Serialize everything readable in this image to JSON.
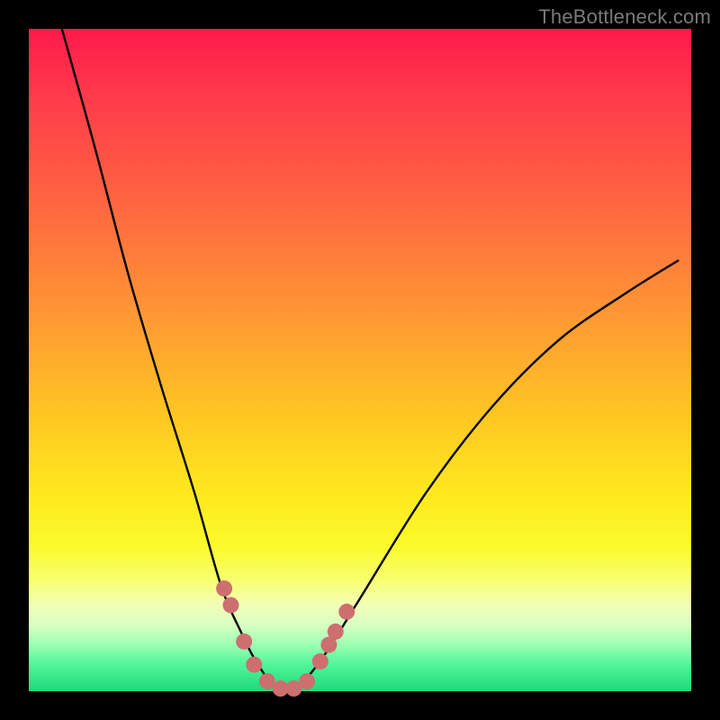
{
  "watermark": "TheBottleneck.com",
  "colors": {
    "frame": "#000000",
    "curve_stroke": "#000000",
    "marker_fill": "#cd6f6f",
    "marker_stroke": "#b85a5a"
  },
  "chart_data": {
    "type": "line",
    "title": "",
    "xlabel": "",
    "ylabel": "",
    "xlim": [
      0,
      100
    ],
    "ylim": [
      0,
      100
    ],
    "series": [
      {
        "name": "bottleneck-curve",
        "x": [
          5,
          10,
          15,
          20,
          25,
          29,
          32,
          34,
          36,
          38,
          40,
          42,
          45,
          50,
          60,
          70,
          80,
          90,
          98
        ],
        "y": [
          100,
          82,
          63,
          46,
          30,
          16,
          9,
          5,
          2,
          0,
          0,
          2,
          6,
          14,
          30,
          43,
          53,
          60,
          65
        ]
      }
    ],
    "markers": [
      {
        "x": 29.5,
        "y": 15.5
      },
      {
        "x": 30.5,
        "y": 13.0
      },
      {
        "x": 32.5,
        "y": 7.5
      },
      {
        "x": 34.0,
        "y": 4.0
      },
      {
        "x": 36.0,
        "y": 1.5
      },
      {
        "x": 38.0,
        "y": 0.4
      },
      {
        "x": 40.0,
        "y": 0.4
      },
      {
        "x": 42.0,
        "y": 1.5
      },
      {
        "x": 44.0,
        "y": 4.5
      },
      {
        "x": 45.3,
        "y": 7.0
      },
      {
        "x": 46.3,
        "y": 9.0
      },
      {
        "x": 48.0,
        "y": 12.0
      }
    ],
    "marker_radius": 9
  }
}
